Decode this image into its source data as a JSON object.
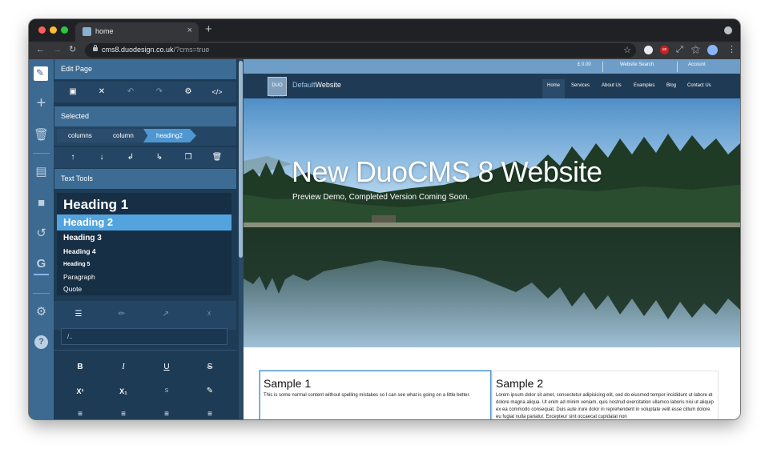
{
  "browser": {
    "tab_title": "home",
    "new_tab": "+",
    "url_host": "cms8.duodesign.co.uk",
    "url_path": "/?cms=true",
    "ext_badge": "uo"
  },
  "editor": {
    "edit_page": {
      "title": "Edit Page",
      "icons": [
        "save-icon",
        "close-icon",
        "undo-icon",
        "redo-icon",
        "gear-icon",
        "code-icon"
      ]
    },
    "selected": {
      "title": "Selected",
      "breadcrumbs": [
        "columns",
        "column",
        "heading2"
      ],
      "icons": [
        "move-up-icon",
        "move-down-icon",
        "indent-icon",
        "outdent-icon",
        "duplicate-icon",
        "delete-icon"
      ]
    },
    "text_tools": {
      "title": "Text Tools",
      "headings": [
        "Heading 1",
        "Heading 2",
        "Heading 3",
        "Heading 4",
        "Heading 5",
        "Paragraph",
        "Quote"
      ],
      "selected_index": 1
    },
    "link": {
      "value": "/..",
      "icons": [
        "sitemap-icon",
        "brush-icon",
        "external-link-icon",
        "unlink-icon"
      ]
    },
    "format": {
      "bold": "B",
      "italic": "I",
      "underline": "U",
      "strike": "S",
      "superscript": "X¹",
      "subscript": "X₁",
      "smallcaps": "S"
    }
  },
  "website": {
    "topbar": {
      "price": "£ 0.00",
      "search": "Website Search",
      "account": "Account"
    },
    "logo": "DUO",
    "logo_sub": "DESIGN",
    "brand_a": "Default",
    "brand_b": "Website",
    "nav": [
      "Home",
      "Services",
      "About Us",
      "Examples",
      "Blog",
      "Contact Us"
    ],
    "hero": {
      "title": "New DuoCMS 8 Website",
      "subtitle": "Preview Demo, Completed Version Coming Soon."
    },
    "sample1": {
      "title": "Sample 1",
      "text": "This is some normal content without spelling mistakes so I can see what is going on a little better."
    },
    "sample2": {
      "title": "Sample 2",
      "text": "Lorem ipsum dolor sit amet, consectetur adipisicing elit, sed do eiusmod tempor incididunt ut labore et dolore magna aliqua. Ut enim ad minim veniam, quis nostrud exercitation ullamco laboris nisi ut aliquip ex ea commodo consequat. Duis aute irure dolor in reprehenderit in voluptate velit esse cillum dolore eu fugiat nulla pariatur. Excepteur sint occaecat cupidatat non"
    }
  },
  "colors": {
    "rail": "#3d6a91",
    "panel": "#1d3b55",
    "panel_header": "#3c6c94",
    "accent": "#53a4de",
    "site_nav": "#1f3a55"
  }
}
